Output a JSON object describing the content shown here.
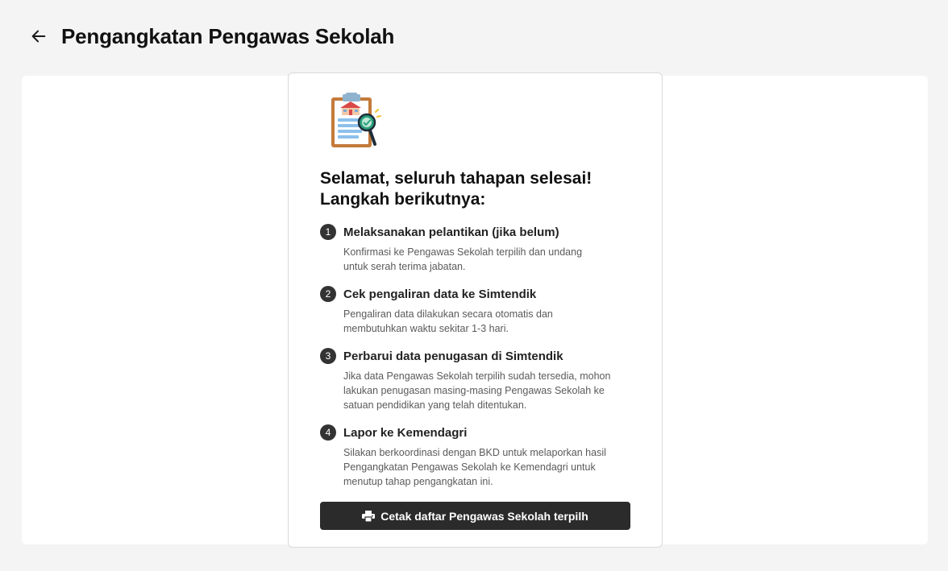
{
  "header": {
    "title": "Pengangkatan Pengawas Sekolah",
    "back_icon": "arrow-left-icon"
  },
  "card": {
    "illustration_icon": "clipboard-search-icon",
    "heading_line1": "Selamat, seluruh tahapan selesai!",
    "heading_line2": "Langkah berikutnya:",
    "steps": [
      {
        "number": "1",
        "title": "Melaksanakan pelantikan (jika belum)",
        "description": "Konfirmasi ke Pengawas Sekolah terpilih dan undang untuk serah terima jabatan."
      },
      {
        "number": "2",
        "title": "Cek pengaliran data ke Simtendik",
        "description": "Pengaliran data dilakukan secara otomatis dan membutuhkan waktu sekitar 1-3 hari."
      },
      {
        "number": "3",
        "title": "Perbarui data penugasan di Simtendik",
        "description": "Jika data Pengawas Sekolah terpilih sudah tersedia, mohon lakukan penugasan masing-masing Pengawas Sekolah ke satuan pendidikan yang telah ditentukan."
      },
      {
        "number": "4",
        "title": "Lapor ke Kemendagri",
        "description": "Silakan berkoordinasi dengan BKD untuk melaporkan hasil Pengangkatan Pengawas Sekolah ke Kemendagri untuk menutup tahap pengangkatan ini."
      }
    ],
    "print_button": {
      "label": "Cetak daftar Pengawas Sekolah terpilh",
      "icon": "printer-icon"
    }
  },
  "colors": {
    "background": "#f4f4f4",
    "panel": "#ffffff",
    "button": "#2b2b2b",
    "step_badge": "#333333"
  }
}
